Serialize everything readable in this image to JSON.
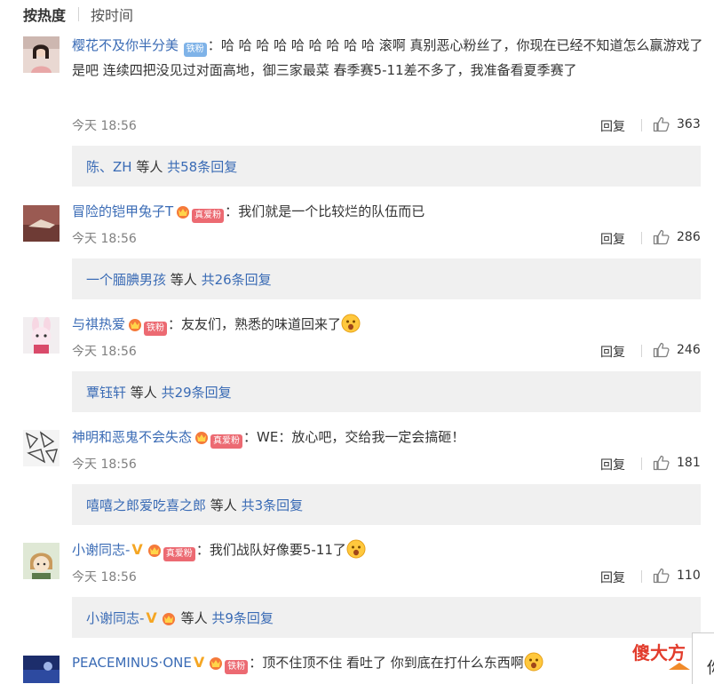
{
  "sort": {
    "hot": "按热度",
    "time": "按时间"
  },
  "labels": {
    "reply": "回复",
    "iron_fan": "铁粉",
    "true_love": "真爱粉",
    "others_prefix": "等人",
    "colon": "："
  },
  "comments": [
    {
      "user": "樱花不及你半分美",
      "text": "哈 哈 哈 哈 哈 哈 哈 哈 哈 滚啊 真别恶心粉丝了，你现在已经不知道怎么赢游戏了是吧 连续四把没见过对面高地，御三家最菜 春季赛5-11差不多了，我准备看夏季赛了",
      "time": "今天 18:56",
      "likes": "363",
      "sub_names": "陈、ZH",
      "sub_total": "共58条回复"
    },
    {
      "user": "冒险的铠甲兔子T",
      "text": "我们就是一个比较烂的队伍而已",
      "time": "今天 18:56",
      "likes": "286",
      "sub_names": "一个腼腆男孩",
      "sub_total": "共26条回复"
    },
    {
      "user": "与祺热爱",
      "text": "友友们，熟悉的味道回来了",
      "time": "今天 18:56",
      "likes": "246",
      "sub_names": "覃钰轩",
      "sub_total": "共29条回复"
    },
    {
      "user": "神明和恶鬼不会失态",
      "text": "WE：放心吧，交给我一定会搞砸！",
      "time": "今天 18:56",
      "likes": "181",
      "sub_names": "嘻嘻之郎爱吃喜之郎",
      "sub_total": "共3条回复"
    },
    {
      "user": "小谢同志-",
      "text": "我们战队好像要5-11了",
      "time": "今天 18:56",
      "likes": "110",
      "sub_names": "小谢同志-",
      "sub_total": "共9条回复"
    },
    {
      "user": "PEACEMINUS·ONE",
      "text": "顶不住顶不住 看吐了 你到底在打什么东西啊"
    }
  ],
  "watermark": "傻大方",
  "panel_char": "你",
  "colors": {
    "link": "#3a6bb5",
    "iron_badge": "#7fb3e8",
    "love_badge": "#ec6a72",
    "subbox": "#f0f0f0",
    "watermark": "#e23c2c"
  }
}
